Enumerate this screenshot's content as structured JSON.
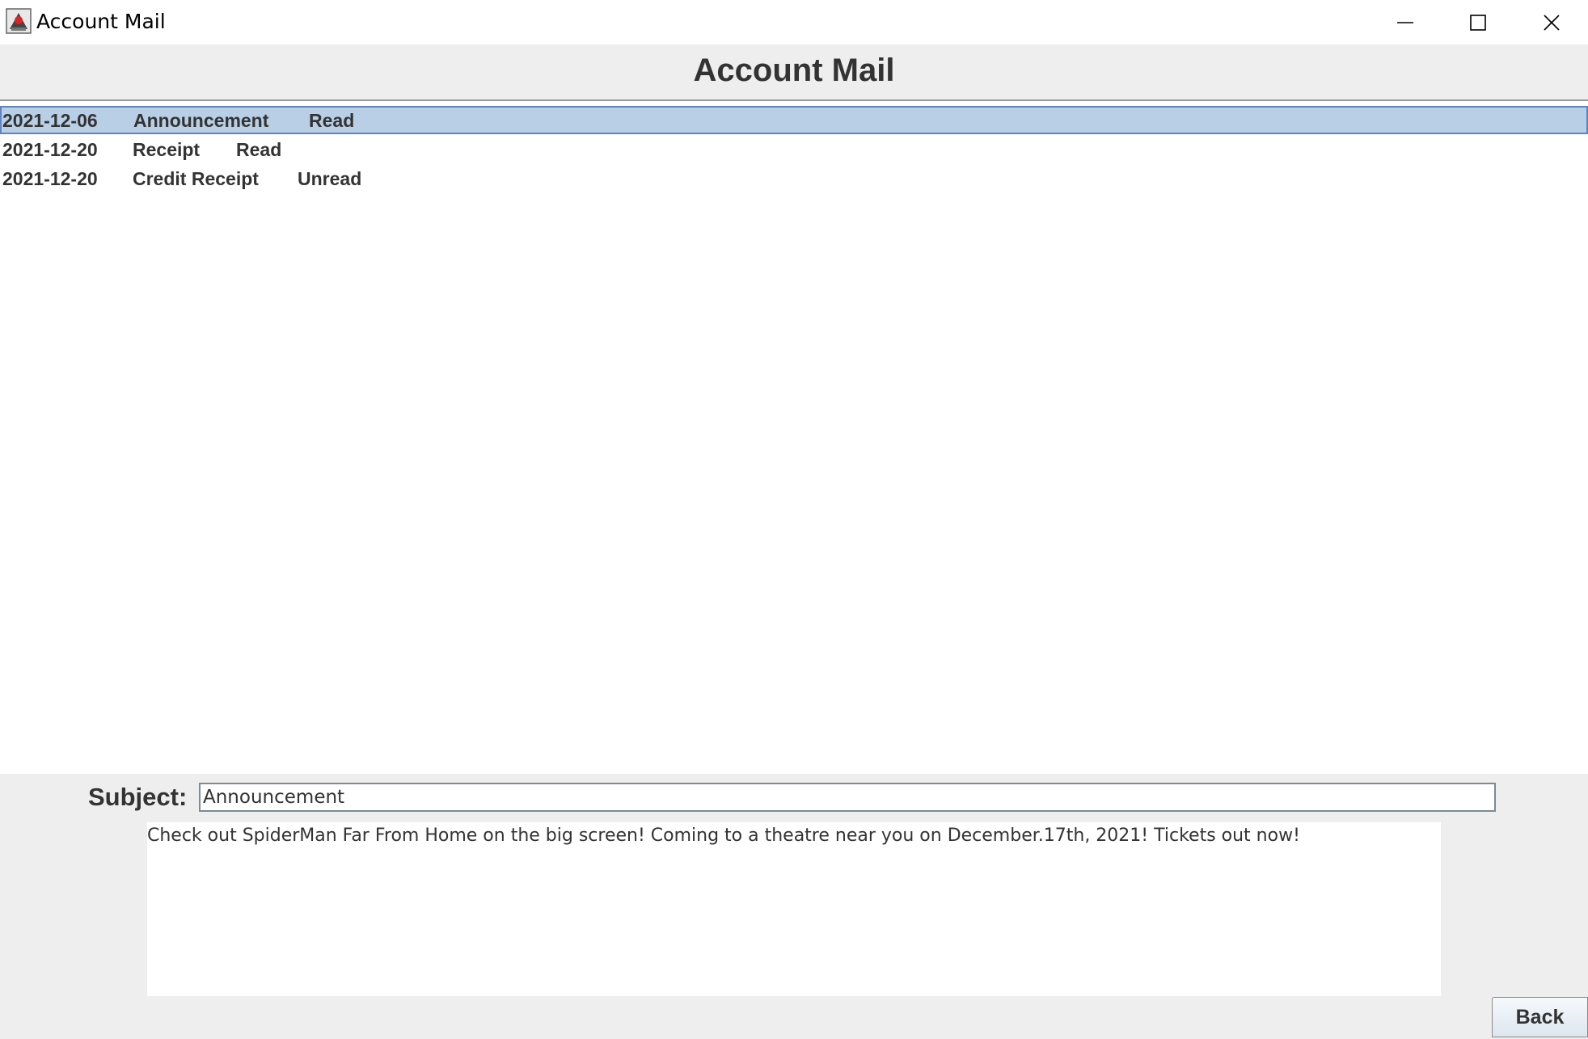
{
  "window": {
    "title": "Account Mail",
    "icon": "java-app-icon",
    "controls": [
      "minimize-icon",
      "maximize-icon",
      "close-icon"
    ]
  },
  "header": {
    "title": "Account Mail"
  },
  "mail_list": {
    "items": [
      {
        "date": "2021-12-06",
        "subject": "Announcement",
        "status": "Read",
        "selected": true
      },
      {
        "date": "2021-12-20",
        "subject": "Receipt",
        "status": "Read",
        "selected": false
      },
      {
        "date": "2021-12-20",
        "subject": "Credit Receipt",
        "status": "Unread",
        "selected": false
      }
    ]
  },
  "detail": {
    "subject_label": "Subject:",
    "subject_value": "Announcement",
    "body": "Check out SpiderMan Far From Home on the big screen! Coming to a theatre near you on December.17th, 2021! Tickets out now!"
  },
  "actions": {
    "back_label": "Back"
  },
  "colors": {
    "selection_bg": "#b8cfe5",
    "selection_border": "#6382bf",
    "panel_bg": "#eeeeee"
  }
}
